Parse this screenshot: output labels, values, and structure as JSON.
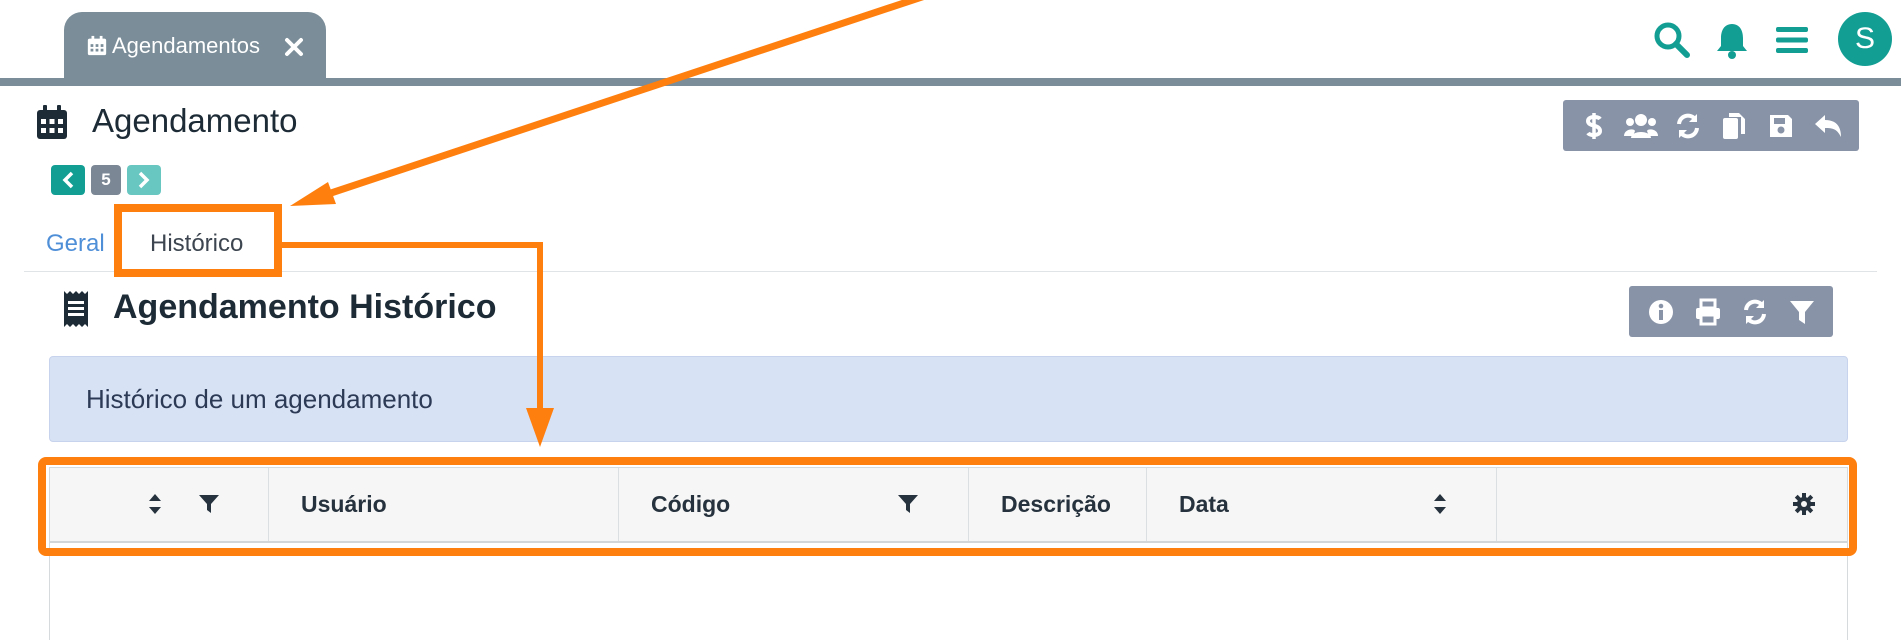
{
  "top_tab": {
    "label": "Agendamentos",
    "icon": "calendar-icon",
    "close_icon": "close-icon"
  },
  "top_actions": [
    "search-icon",
    "bell-icon",
    "menu-icon"
  ],
  "avatar": {
    "initial": "S",
    "color": "#139e94"
  },
  "page": {
    "title": "Agendamento",
    "icon": "calendar-icon"
  },
  "main_toolbar": [
    "dollar-icon",
    "users-icon",
    "sync-icon",
    "copy-icon",
    "save-icon",
    "undo-icon"
  ],
  "pager": {
    "current": "5"
  },
  "tabs": [
    {
      "label": "Geral",
      "active": false
    },
    {
      "label": "Histórico",
      "active": true
    }
  ],
  "section": {
    "title": "Agendamento Histórico",
    "icon": "receipt-icon"
  },
  "section_toolbar": [
    "info-icon",
    "print-icon",
    "sync-icon",
    "filter-icon"
  ],
  "info_text": "Histórico de um agendamento",
  "table": {
    "columns": [
      {
        "label": "",
        "sortable": true,
        "filter": true
      },
      {
        "label": "Usuário"
      },
      {
        "label": "Código",
        "filter": true
      },
      {
        "label": "Descrição"
      },
      {
        "label": "Data",
        "sortable": true
      },
      {
        "label": "",
        "settings": true
      }
    ],
    "rows": []
  },
  "colors": {
    "accent": "#139e94",
    "toolbar": "#8893a7",
    "tab_bar": "#7a8d98",
    "annotation": "#ff7f0e",
    "info_bg": "#d8e2f5"
  }
}
